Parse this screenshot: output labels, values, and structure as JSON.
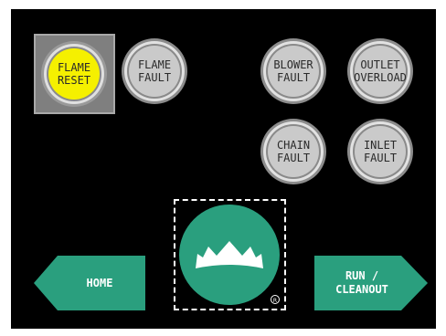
{
  "indicators": {
    "flame_reset": {
      "line1": "FLAME",
      "line2": "RESET",
      "state": "active",
      "color": "#f5f000"
    },
    "flame_fault": {
      "line1": "FLAME",
      "line2": "FAULT",
      "state": "inactive",
      "color": "#c8c8c8"
    },
    "blower_fault": {
      "line1": "BLOWER",
      "line2": "FAULT",
      "state": "inactive",
      "color": "#c8c8c8"
    },
    "outlet_overload": {
      "line1": "OUTLET",
      "line2": "OVERLOAD",
      "state": "inactive",
      "color": "#c8c8c8"
    },
    "chain_fault": {
      "line1": "CHAIN",
      "line2": "FAULT",
      "state": "inactive",
      "color": "#c8c8c8"
    },
    "inlet_fault": {
      "line1": "INLET",
      "line2": "FAULT",
      "state": "inactive",
      "color": "#c8c8c8"
    }
  },
  "crown_button": {
    "icon": "crown-icon",
    "badge_icon": "registered-icon",
    "color": "#2a9f7e"
  },
  "nav": {
    "home": {
      "label": "HOME",
      "icon": "arrow-left-icon",
      "color": "#2a9f7e"
    },
    "run_cleanout": {
      "line1": "RUN /",
      "line2": "CLEANOUT",
      "icon": "arrow-right-icon",
      "color": "#2a9f7e"
    }
  }
}
